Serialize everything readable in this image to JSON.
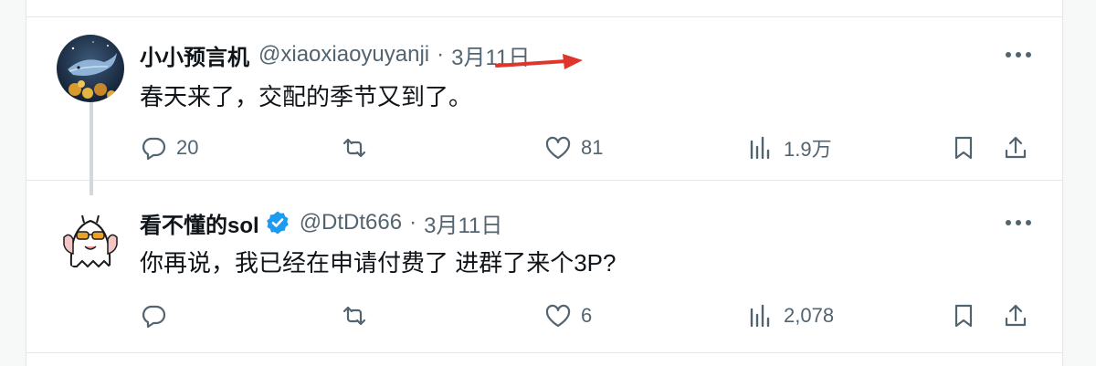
{
  "tweets": [
    {
      "name": "小小预言机",
      "handle": "@xiaoxiaoyuyanji",
      "separator": "·",
      "time": "3月11日",
      "verified": false,
      "text": "春天来了，交配的季节又到了。",
      "counts": {
        "reply": "20",
        "retweet": "",
        "like": "81",
        "views": "1.9万"
      },
      "avatar_icon": "whale-avatar-icon"
    },
    {
      "name": "看不懂的sol",
      "handle": "@DtDt666",
      "separator": "·",
      "time": "3月11日",
      "verified": true,
      "text": "你再说，我已经在申请付费了 进群了来个3P?",
      "counts": {
        "reply": "",
        "retweet": "",
        "like": "6",
        "views": "2,078"
      },
      "avatar_icon": "ghost-sunglasses-avatar-icon"
    }
  ],
  "icons": {
    "more": "more-dots-icon",
    "reply": "reply-bubble-icon",
    "retweet": "retweet-icon",
    "like": "heart-icon",
    "views": "views-chart-icon",
    "bookmark": "bookmark-icon",
    "share": "share-upload-icon",
    "annotation": "red-arrow-annotation-icon"
  },
  "colors": {
    "text_primary": "#0f1419",
    "text_secondary": "#536471",
    "verified_blue": "#1d9bf0",
    "divider": "#e3e7ea",
    "thread_line": "#cfd9de",
    "annotation_red": "#e0352b"
  }
}
